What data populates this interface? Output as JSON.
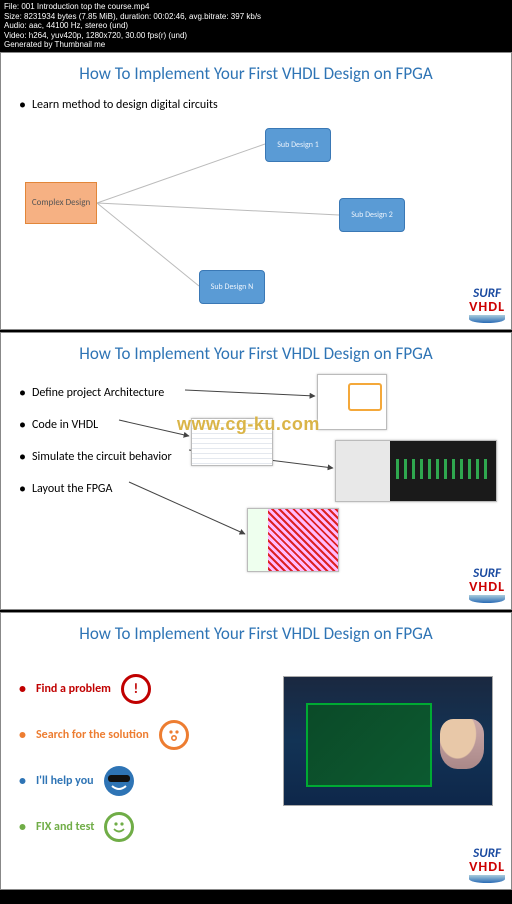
{
  "meta": {
    "file": "File: 001 Introduction top the course.mp4",
    "size": "Size: 8231934 bytes (7.85 MiB), duration: 00:02:46, avg.bitrate: 397 kb/s",
    "audio": "Audio: aac, 44100 Hz, stereo (und)",
    "video": "Video: h264, yuv420p, 1280x720, 30.00 fps(r) (und)",
    "gen": "Generated by Thumbnail me"
  },
  "title": "How To Implement Your First VHDL Design on FPGA",
  "logo": {
    "top": "SURF",
    "bottom": "VHDL"
  },
  "watermark": "www.cg-ku.com",
  "slide1": {
    "bullet": "Learn method to design digital circuits",
    "complex": "Complex Design",
    "sub1": "Sub Design 1",
    "sub2": "Sub Design 2",
    "subN": "Sub Design N"
  },
  "slide2": {
    "b1": "Define project Architecture",
    "b2": "Code in VHDL",
    "b3": "Simulate the circuit behavior",
    "b4": "Layout the FPGA"
  },
  "slide3": {
    "r1": "Find a problem",
    "r2": "Search for the solution",
    "r3": "I'll help you",
    "r4": "FIX and test"
  }
}
